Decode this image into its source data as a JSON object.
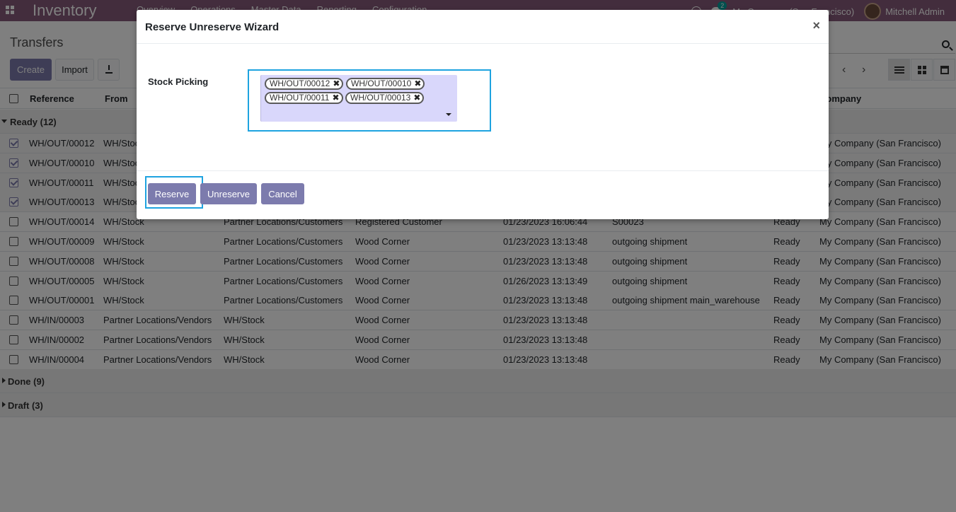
{
  "navbar": {
    "app_name": "Inventory",
    "menu": [
      "Overview",
      "Operations",
      "Master Data",
      "Reporting",
      "Configuration"
    ],
    "chat_count": "2",
    "company": "My Company (San Francisco)",
    "user": "Mitchell Admin"
  },
  "control_panel": {
    "title": "Transfers",
    "create_label": "Create",
    "import_label": "Import"
  },
  "table": {
    "headers": {
      "reference": "Reference",
      "from": "From",
      "company": "Company"
    },
    "groups": {
      "ready": "Ready (12)",
      "done": "Done (9)",
      "draft": "Draft (3)"
    },
    "rows": [
      {
        "ref": "WH/OUT/00012",
        "from": "WH/Stock",
        "to": "",
        "contact": "",
        "date": "",
        "origin": "",
        "status": "",
        "company": "My Company (San Francisco)",
        "checked": true
      },
      {
        "ref": "WH/OUT/00010",
        "from": "WH/Stock",
        "to": "",
        "contact": "",
        "date": "",
        "origin": "",
        "status": "",
        "company": "My Company (San Francisco)",
        "checked": true
      },
      {
        "ref": "WH/OUT/00011",
        "from": "WH/Stock",
        "to": "",
        "contact": "",
        "date": "",
        "origin": "",
        "status": "",
        "company": "My Company (San Francisco)",
        "checked": true
      },
      {
        "ref": "WH/OUT/00013",
        "from": "WH/Stock",
        "to": "",
        "contact": "",
        "date": "",
        "origin": "",
        "status": "",
        "company": "My Company (San Francisco)",
        "checked": true
      },
      {
        "ref": "WH/OUT/00014",
        "from": "WH/Stock",
        "to": "Partner Locations/Customers",
        "contact": "Registered Customer",
        "date": "01/23/2023 16:06:44",
        "origin": "S00023",
        "status": "Ready",
        "company": "My Company (San Francisco)",
        "checked": false
      },
      {
        "ref": "WH/OUT/00009",
        "from": "WH/Stock",
        "to": "Partner Locations/Customers",
        "contact": "Wood Corner",
        "date": "01/23/2023 13:13:48",
        "origin": "outgoing shipment",
        "status": "Ready",
        "company": "My Company (San Francisco)",
        "checked": false
      },
      {
        "ref": "WH/OUT/00008",
        "from": "WH/Stock",
        "to": "Partner Locations/Customers",
        "contact": "Wood Corner",
        "date": "01/23/2023 13:13:48",
        "origin": "outgoing shipment",
        "status": "Ready",
        "company": "My Company (San Francisco)",
        "checked": false
      },
      {
        "ref": "WH/OUT/00005",
        "from": "WH/Stock",
        "to": "Partner Locations/Customers",
        "contact": "Wood Corner",
        "date": "01/26/2023 13:13:49",
        "origin": "outgoing shipment",
        "status": "Ready",
        "company": "My Company (San Francisco)",
        "checked": false
      },
      {
        "ref": "WH/OUT/00001",
        "from": "WH/Stock",
        "to": "Partner Locations/Customers",
        "contact": "Wood Corner",
        "date": "01/23/2023 13:13:48",
        "origin": "outgoing shipment main_warehouse",
        "status": "Ready",
        "company": "My Company (San Francisco)",
        "checked": false
      },
      {
        "ref": "WH/IN/00003",
        "from": "Partner Locations/Vendors",
        "to": "WH/Stock",
        "contact": "Wood Corner",
        "date": "01/23/2023 13:13:48",
        "origin": "",
        "status": "Ready",
        "company": "My Company (San Francisco)",
        "checked": false
      },
      {
        "ref": "WH/IN/00002",
        "from": "Partner Locations/Vendors",
        "to": "WH/Stock",
        "contact": "Wood Corner",
        "date": "01/23/2023 13:13:48",
        "origin": "",
        "status": "Ready",
        "company": "My Company (San Francisco)",
        "checked": false
      },
      {
        "ref": "WH/IN/00004",
        "from": "Partner Locations/Vendors",
        "to": "WH/Stock",
        "contact": "Wood Corner",
        "date": "01/23/2023 13:13:48",
        "origin": "",
        "status": "Ready",
        "company": "My Company (San Francisco)",
        "checked": false
      }
    ]
  },
  "modal": {
    "title": "Reserve Unreserve Wizard",
    "close_glyph": "×",
    "field_label": "Stock Picking",
    "tags": [
      "WH/OUT/00012",
      "WH/OUT/00010",
      "WH/OUT/00011",
      "WH/OUT/00013"
    ],
    "tag_remove_glyph": "✖",
    "buttons": {
      "reserve": "Reserve",
      "unreserve": "Unreserve",
      "cancel": "Cancel"
    }
  }
}
